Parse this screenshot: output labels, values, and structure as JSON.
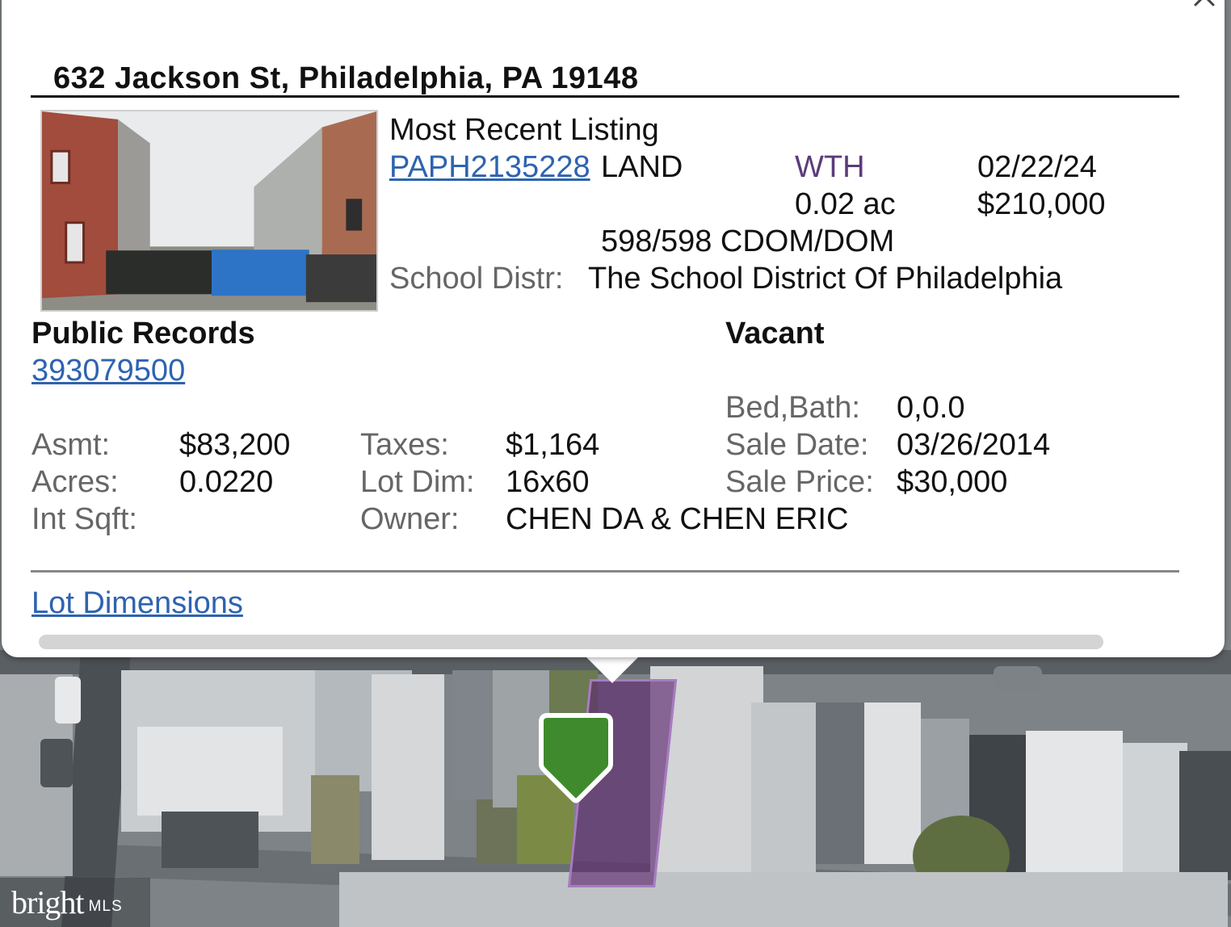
{
  "popup": {
    "address": "632 Jackson St, Philadelphia, PA 19148",
    "listing": {
      "heading": "Most Recent Listing",
      "mls_id": "PAPH2135228",
      "type": "LAND",
      "status": "WTH",
      "date": "02/22/24",
      "acres": "0.02 ac",
      "price": "$210,000",
      "dom": "598/598 CDOM/DOM",
      "school_label": "School Distr:",
      "school_value": "The School District Of Philadelphia"
    },
    "records": {
      "heading": "Public Records",
      "parcel_id": "393079500",
      "status": "Vacant",
      "bedbath_label": "Bed,Bath:",
      "bedbath_value": "0,0.0",
      "asmt_label": "Asmt:",
      "asmt_value": "$83,200",
      "taxes_label": "Taxes:",
      "taxes_value": "$1,164",
      "saledate_label": "Sale Date:",
      "saledate_value": "03/26/2014",
      "acres_label": "Acres:",
      "acres_value": "0.0220",
      "lotdim_label": "Lot Dim:",
      "lotdim_value": "16x60",
      "saleprice_label": "Sale Price:",
      "saleprice_value": "$30,000",
      "intsqft_label": "Int Sqft:",
      "owner_label": "Owner:",
      "owner_value": "CHEN DA & CHEN ERIC"
    },
    "lot_dimensions_link": "Lot Dimensions"
  },
  "logo": {
    "brand": "bright",
    "suffix": "MLS"
  },
  "icons": {
    "close": "close-icon",
    "pin": "map-pin-icon"
  },
  "colors": {
    "link": "#2e63b0",
    "status_wth": "#5b3b79",
    "pin": "#3f8a2c",
    "parcel": "#5e286e"
  }
}
